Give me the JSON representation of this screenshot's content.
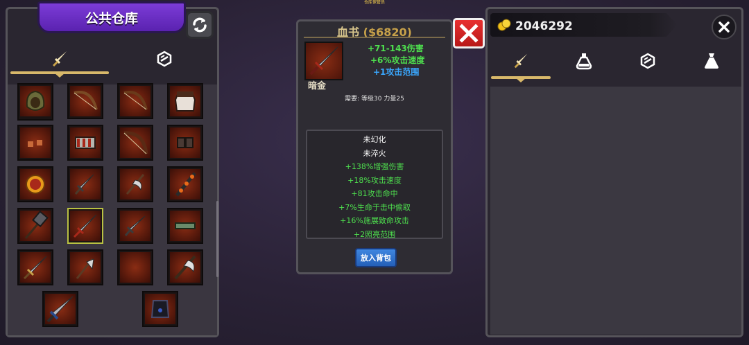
{
  "top_caption": "仓库保管员",
  "left_panel": {
    "title": "公共仓库",
    "tabs": [
      {
        "name": "weapon-tab",
        "icon": "sword-icon",
        "active": true
      },
      {
        "name": "gem-tab",
        "icon": "gem-icon",
        "active": false
      }
    ],
    "slots": [
      {
        "icon": "hood-icon"
      },
      {
        "icon": "bow-icon"
      },
      {
        "icon": "bow-icon"
      },
      {
        "icon": "chestplate-icon"
      },
      {
        "icon": "gloves-icon"
      },
      {
        "icon": "belt-icon"
      },
      {
        "icon": "bow-icon"
      },
      {
        "icon": "bracer-icon"
      },
      {
        "icon": "ring-icon"
      },
      {
        "icon": "sword-icon"
      },
      {
        "icon": "axe-icon"
      },
      {
        "icon": "mace-icon"
      },
      {
        "icon": "hammer-icon"
      },
      {
        "icon": "sword-icon",
        "selected": true
      },
      {
        "icon": "sword-icon"
      },
      {
        "icon": "belt-icon"
      },
      {
        "icon": "sword-icon"
      },
      {
        "icon": "axe-icon"
      },
      {
        "icon": "empty"
      },
      {
        "icon": "axe-icon"
      },
      {
        "icon": "greatsword-icon"
      },
      {
        "icon": "armor-icon"
      }
    ]
  },
  "item_card": {
    "name": "血书",
    "price": "($6820)",
    "grade": "暗金",
    "stats": [
      {
        "text": "+71-143伤害",
        "color": "#4ee04e"
      },
      {
        "text": "+6%攻击速度",
        "color": "#4ee04e"
      },
      {
        "text": "+1攻击范围",
        "color": "#3aa8ff"
      }
    ],
    "requirement": "需要: 等级30 力量25",
    "attributes": [
      {
        "text": "未幻化",
        "color": "#ffffff"
      },
      {
        "text": "未淬火",
        "color": "#ffffff"
      },
      {
        "text": "+138%增强伤害",
        "color": "#4ee04e"
      },
      {
        "text": "+18%攻击速度",
        "color": "#4ee04e"
      },
      {
        "text": "+81攻击命中",
        "color": "#4ee04e"
      },
      {
        "text": "+7%生命于击中偷取",
        "color": "#4ee04e"
      },
      {
        "text": "+16%施展致命攻击",
        "color": "#4ee04e"
      },
      {
        "text": "+2照亮范围",
        "color": "#4ee04e"
      }
    ],
    "button_label": "放入背包"
  },
  "right_panel": {
    "gold": "2046292",
    "tabs": [
      {
        "name": "weapon-tab",
        "icon": "sword-icon",
        "active": true
      },
      {
        "name": "potion-tab",
        "icon": "potion-icon",
        "active": false
      },
      {
        "name": "gem-tab",
        "icon": "gem-icon",
        "active": false
      },
      {
        "name": "bag-tab",
        "icon": "bag-icon",
        "active": false
      }
    ]
  },
  "colors": {
    "banner_purple": "#6a2ec4",
    "accent_gold": "#d8b86a",
    "stat_green": "#4ee04e",
    "stat_blue": "#3aa8ff",
    "close_red": "#d42020",
    "button_blue": "#2f74d0"
  }
}
